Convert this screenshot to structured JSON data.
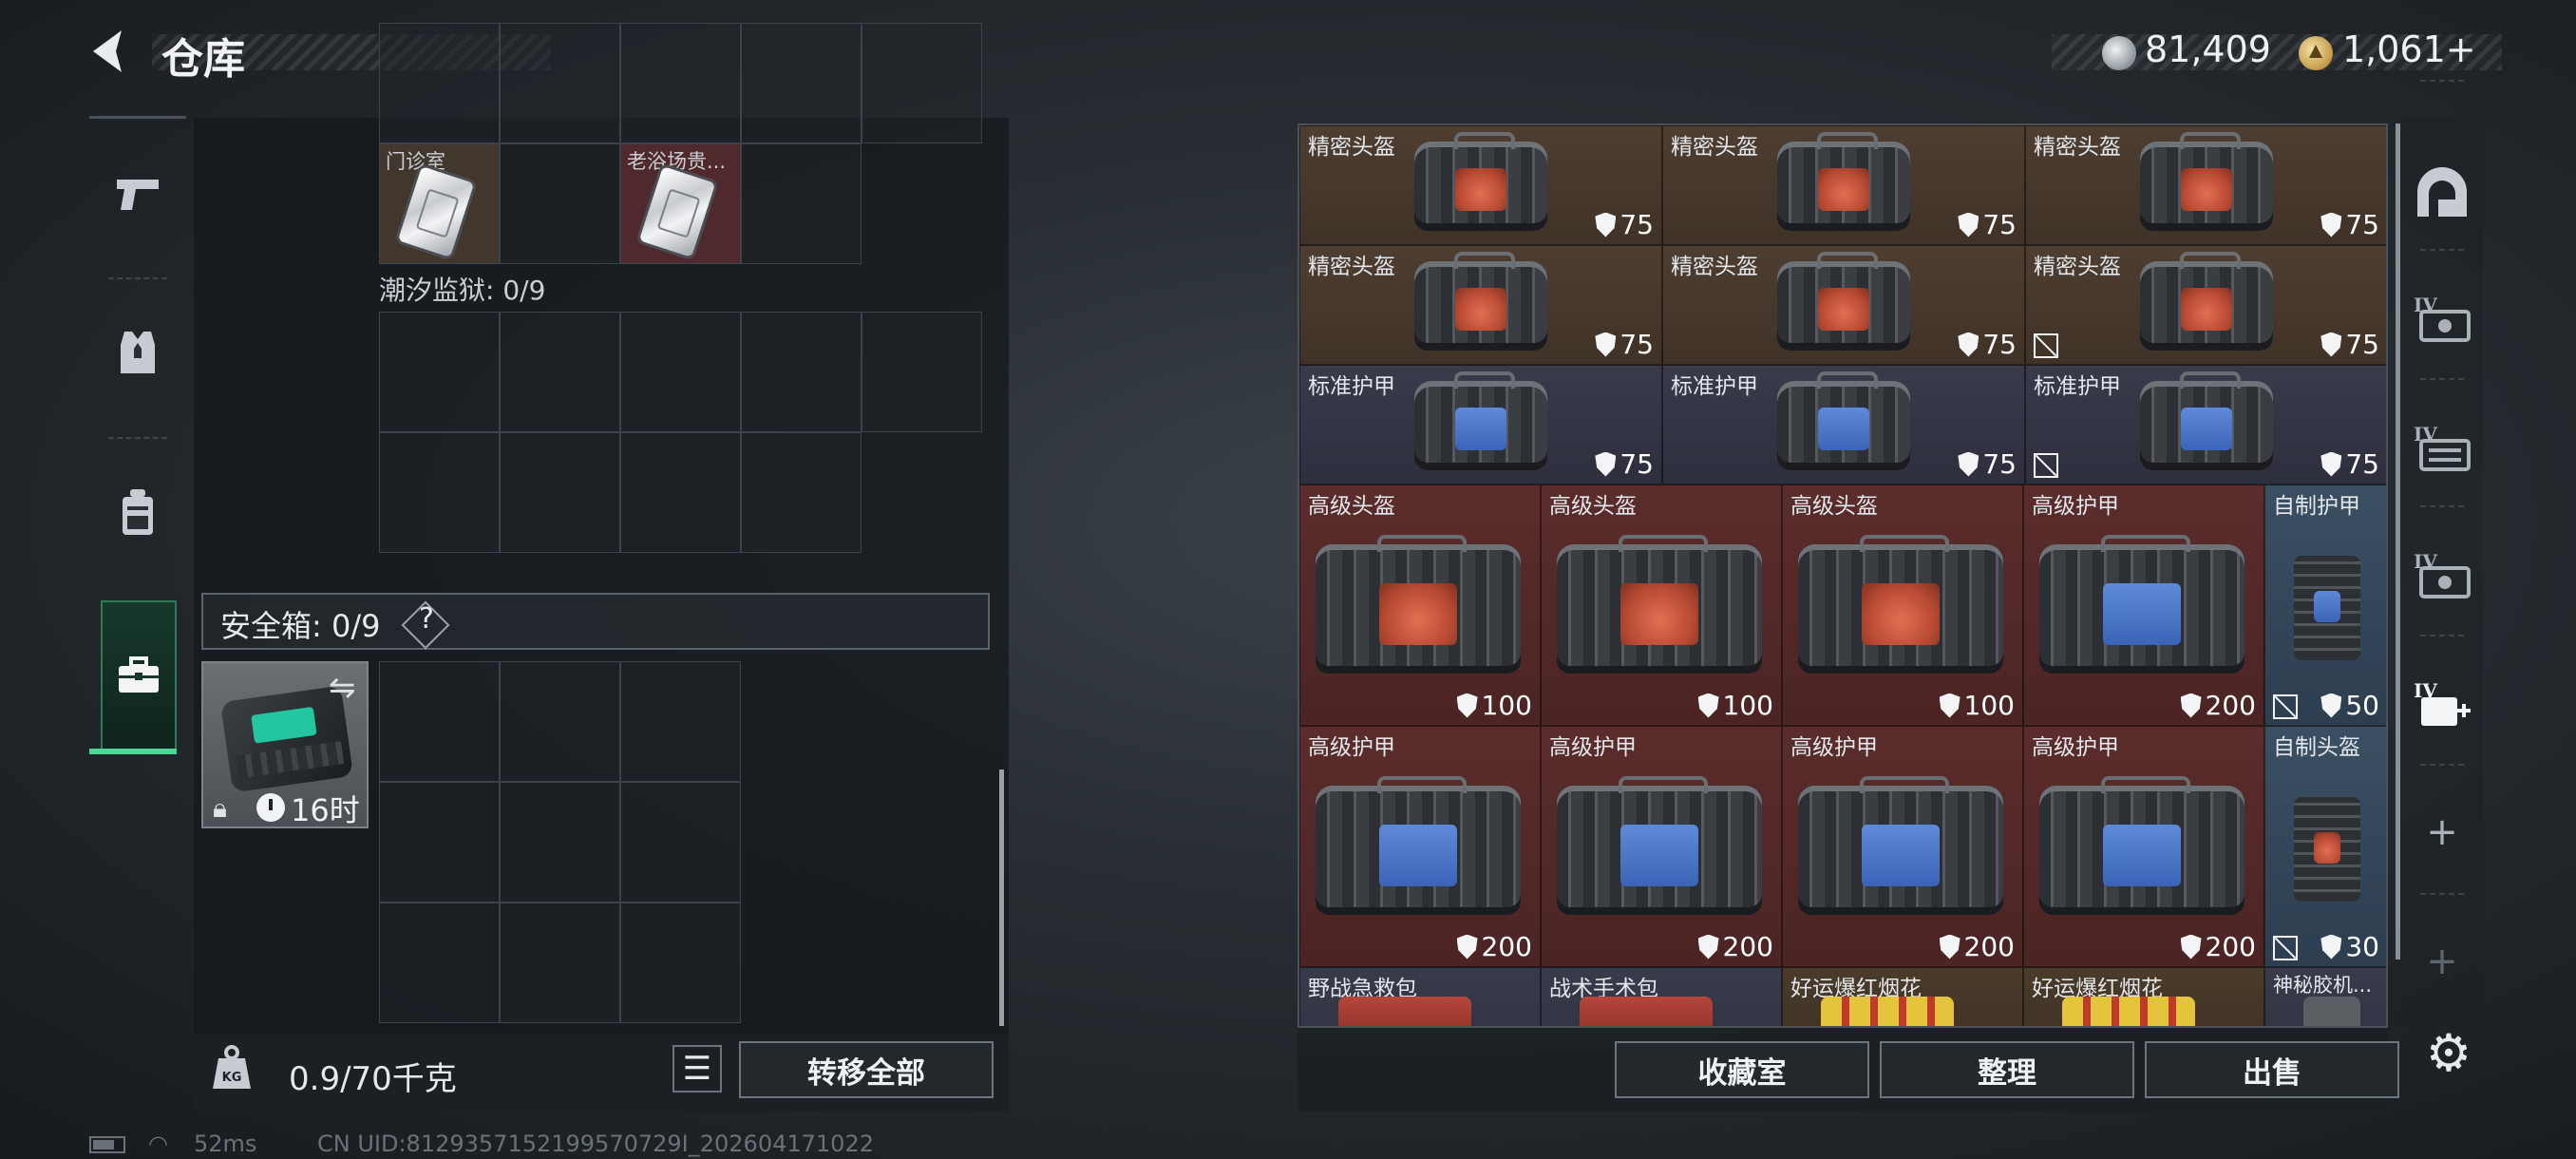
{
  "header": {
    "title": "仓库",
    "back_icon": "back-arrow-icon",
    "currencies": [
      {
        "icon": "silver-coin-icon",
        "amount": "81,409"
      },
      {
        "icon": "gold-coin-icon",
        "amount": "1,061+"
      }
    ]
  },
  "left_tabs": [
    {
      "icon": "pistol-icon",
      "active": false
    },
    {
      "icon": "armor-vest-icon",
      "active": false
    },
    {
      "icon": "backpack-icon",
      "active": false
    },
    {
      "icon": "briefcase-icon",
      "active": true
    }
  ],
  "storage": {
    "top_items": [
      {
        "name": "门诊室",
        "icon": "keycard-icon"
      },
      {
        "name": "老浴场贵...",
        "icon": "keycard-icon"
      }
    ],
    "prison_label": "潮汐监狱: 0/9",
    "safebox_label": "安全箱: 0/9",
    "safebox_help": "?",
    "safebox_item": {
      "icon": "safebox-case-icon",
      "swap_icon": "swap-icon",
      "lock_icon": "lock-icon",
      "timer": "16时"
    }
  },
  "left_bottom": {
    "weight": "0.9/70千克",
    "weight_icon": "weight-kg-icon",
    "list_icon": "list-icon",
    "transfer_all": "转移全部"
  },
  "status": {
    "ping": "52ms",
    "uid": "CN UID:8129357152199570729I_202604171022"
  },
  "inventory": {
    "items": [
      {
        "name": "精密头盔",
        "value": "75",
        "no_repair": false
      },
      {
        "name": "精密头盔",
        "value": "75",
        "no_repair": false
      },
      {
        "name": "精密头盔",
        "value": "75",
        "no_repair": false
      },
      {
        "name": "精密头盔",
        "value": "75",
        "no_repair": false
      },
      {
        "name": "精密头盔",
        "value": "75",
        "no_repair": false
      },
      {
        "name": "精密头盔",
        "value": "75",
        "no_repair": true
      },
      {
        "name": "标准护甲",
        "value": "75",
        "no_repair": false
      },
      {
        "name": "标准护甲",
        "value": "75",
        "no_repair": false
      },
      {
        "name": "标准护甲",
        "value": "75",
        "no_repair": true
      },
      {
        "name": "高级头盔",
        "value": "100",
        "no_repair": false
      },
      {
        "name": "高级头盔",
        "value": "100",
        "no_repair": false
      },
      {
        "name": "高级头盔",
        "value": "100",
        "no_repair": false
      },
      {
        "name": "高级护甲",
        "value": "200",
        "no_repair": false
      },
      {
        "name": "自制护甲",
        "value": "50",
        "no_repair": true
      },
      {
        "name": "高级护甲",
        "value": "200",
        "no_repair": false
      },
      {
        "name": "高级护甲",
        "value": "200",
        "no_repair": false
      },
      {
        "name": "高级护甲",
        "value": "200",
        "no_repair": false
      },
      {
        "name": "高级护甲",
        "value": "200",
        "no_repair": false
      },
      {
        "name": "自制头盔",
        "value": "30",
        "no_repair": true
      },
      {
        "name": "野战急救包",
        "value": "",
        "no_repair": false
      },
      {
        "name": "战术手术包",
        "value": "",
        "no_repair": false
      },
      {
        "name": "好运爆红烟花",
        "value": "",
        "no_repair": false
      },
      {
        "name": "好运爆红烟花",
        "value": "",
        "no_repair": false
      },
      {
        "name": "神秘胶机...",
        "value": "",
        "no_repair": false
      }
    ]
  },
  "right_tabs": [
    {
      "icon": "vault-arch-icon"
    },
    {
      "icon": "storage-iv-1-icon",
      "label": "IV"
    },
    {
      "icon": "storage-iv-2-icon",
      "label": "IV"
    },
    {
      "icon": "storage-iv-3-icon",
      "label": "IV"
    },
    {
      "icon": "storage-iv-add-icon",
      "label": "IV"
    },
    {
      "icon": "add-storage-icon",
      "label": "+"
    },
    {
      "icon": "add-storage-icon",
      "label": "+"
    }
  ],
  "right_bottom": {
    "collection": "收藏室",
    "organize": "整理",
    "sell": "出售",
    "settings_icon": "gear-icon"
  }
}
